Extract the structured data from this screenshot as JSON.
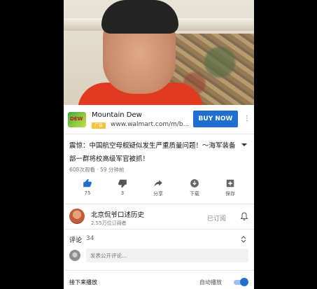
{
  "ad": {
    "brand": "Mountain Dew",
    "thumb_text": "DEW",
    "badge": "广告",
    "url": "www.walmart.com/m/b...",
    "cta": "BUY NOW"
  },
  "video": {
    "title": "震惊：中国航空母舰疑似发生严重质量问题！～海军装备部一群将校高级军官被抓！",
    "views": "608次观看",
    "time": "59 分钟前",
    "separator": "·"
  },
  "actions": [
    {
      "icon": "thumbs-up-icon",
      "label": "75"
    },
    {
      "icon": "thumbs-down-icon",
      "label": "3"
    },
    {
      "icon": "share-icon",
      "label": "分享"
    },
    {
      "icon": "download-icon",
      "label": "下载"
    },
    {
      "icon": "save-icon",
      "label": "保存"
    }
  ],
  "channel": {
    "name": "北京侃爷口述历史",
    "subscribers": "2.55万位订阅者",
    "subscribed_label": "已订阅"
  },
  "comments": {
    "label": "评论",
    "count": "34",
    "placeholder": "发表公开评论..."
  },
  "footer": {
    "up_next": "接下来播放",
    "autoplay": "自动播放"
  },
  "colors": {
    "accent": "#1f6fd1",
    "like_active": "#1f6fd1"
  }
}
